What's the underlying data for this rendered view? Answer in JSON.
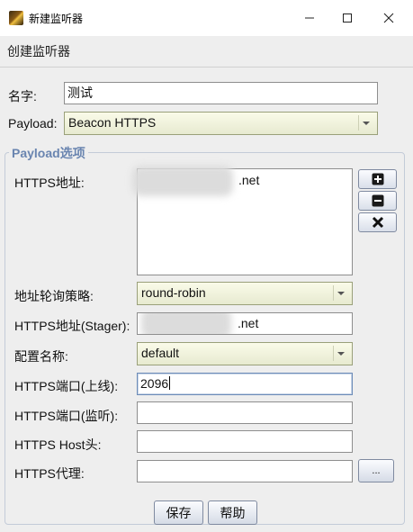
{
  "window": {
    "title": "新建监听器"
  },
  "header": {
    "subtitle": "创建监听器"
  },
  "form": {
    "name": {
      "label": "名字:",
      "value": "测试"
    },
    "payload": {
      "label": "Payload:",
      "value": "Beacon HTTPS"
    },
    "group_title": "Payload选项",
    "https_hosts": {
      "label": "HTTPS地址:",
      "items": [
        ".net"
      ]
    },
    "host_rotation": {
      "label": "地址轮询策略:",
      "value": "round-robin"
    },
    "stager_host": {
      "label": "HTTPS地址(Stager):",
      "value": ".net"
    },
    "profile": {
      "label": "配置名称:",
      "value": "default"
    },
    "port_c2": {
      "label": "HTTPS端口(上线):",
      "value": "2096"
    },
    "port_bind": {
      "label": "HTTPS端口(监听):",
      "value": ""
    },
    "host_header": {
      "label": "HTTPS Host头:",
      "value": ""
    },
    "proxy": {
      "label": "HTTPS代理:",
      "value": "",
      "button": "..."
    }
  },
  "buttons": {
    "save": "保存",
    "help": "帮助"
  },
  "icons": {
    "minimize": "minimize-icon",
    "maximize": "maximize-icon",
    "close": "close-icon",
    "add": "plus-icon",
    "remove": "minus-icon",
    "clear": "x-icon",
    "dropdown": "chevron-down-icon"
  }
}
